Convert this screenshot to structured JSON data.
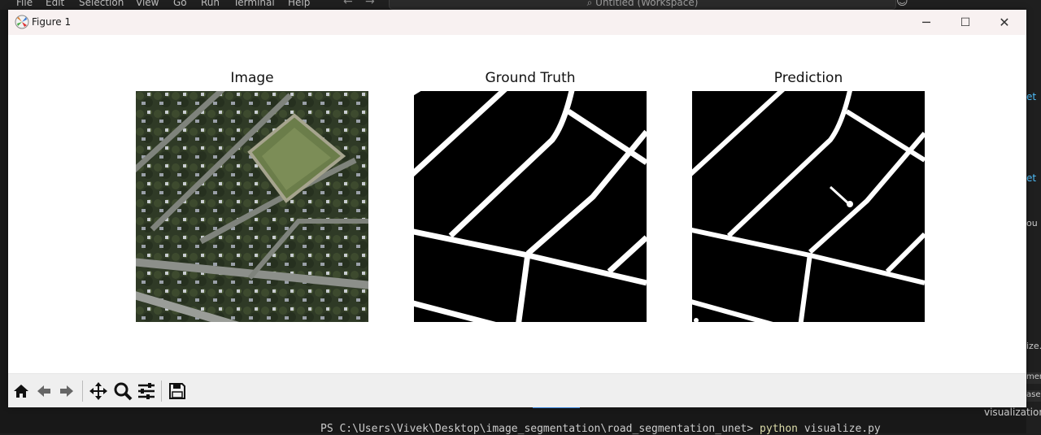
{
  "background_ide": {
    "menu": [
      "File",
      "Edit",
      "Selection",
      "View",
      "Go",
      "Run",
      "Terminal",
      "Help"
    ],
    "search_text": "Untitled (Workspace)",
    "terminal_prompt": "PS C:\\Users\\Vivek\\Desktop\\image_segmentation\\road_segmentation_unet>",
    "terminal_cmd_python": "python",
    "terminal_cmd_rest": " visualize.py",
    "right_panel_label": "visualization",
    "right_fragments": [
      "et",
      "et",
      "ou",
      "ize.p",
      "men",
      "ase"
    ]
  },
  "window": {
    "title": "Figure 1",
    "controls": {
      "minimize": "─",
      "maximize": "☐",
      "close": "✕"
    }
  },
  "subplots": [
    {
      "title": "Image"
    },
    {
      "title": "Ground Truth"
    },
    {
      "title": "Prediction"
    }
  ],
  "toolbar": {
    "tools": [
      "home-icon",
      "back-icon",
      "forward-icon",
      "pan-icon",
      "zoom-icon",
      "configure-subplots-icon",
      "save-icon"
    ]
  }
}
